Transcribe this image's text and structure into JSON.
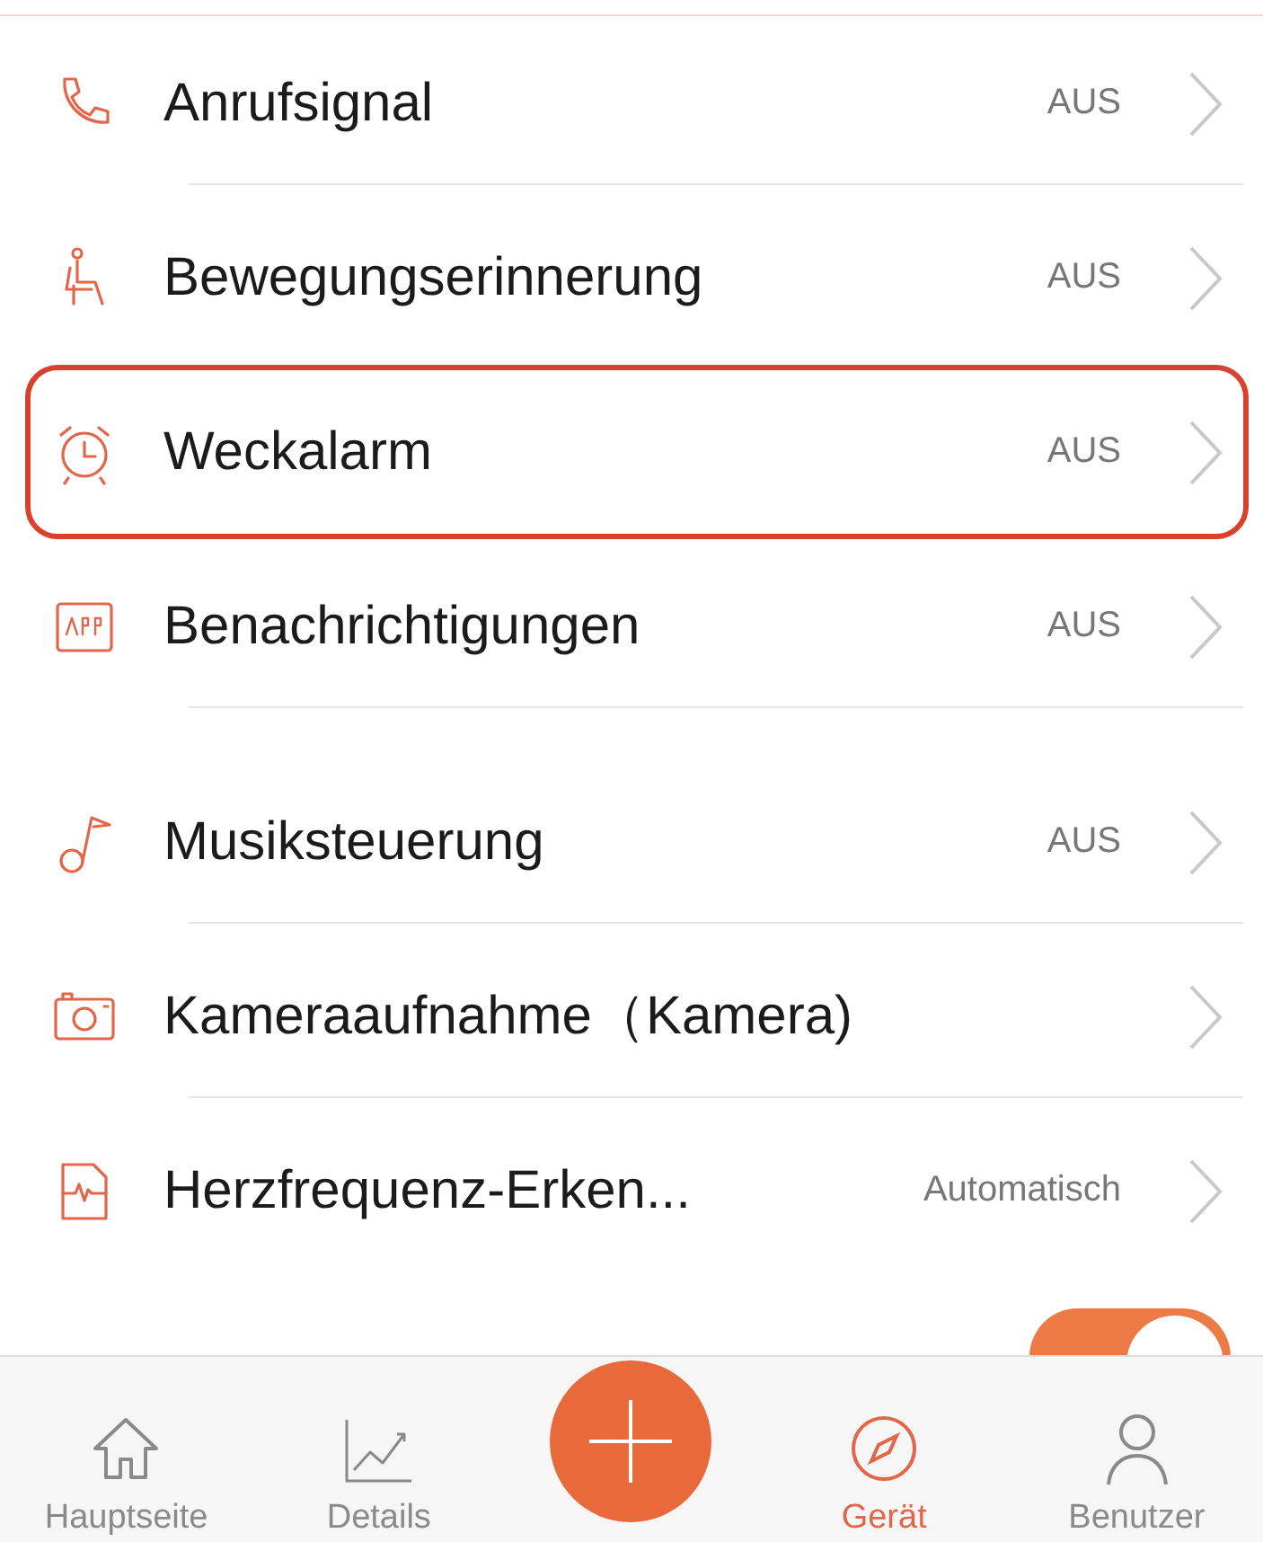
{
  "settings": [
    {
      "label": "Anrufsignal",
      "value": "AUS",
      "highlighted": false
    },
    {
      "label": "Bewegungserinnerung",
      "value": "AUS",
      "highlighted": false
    },
    {
      "label": "Weckalarm",
      "value": "AUS",
      "highlighted": true
    },
    {
      "label": "Benachrichtigungen",
      "value": "AUS",
      "highlighted": false
    },
    {
      "label": "Musiksteuerung",
      "value": "AUS",
      "highlighted": false
    },
    {
      "label": "Kameraaufnahme（Kamera)",
      "highlighted": false
    },
    {
      "label": "Herzfrequenz-Erken...",
      "value": "Automatisch",
      "highlighted": false
    }
  ],
  "partial_row": {
    "on": true
  },
  "tab_bar": [
    {
      "kind": "tab",
      "label": "Hauptseite",
      "selected": false
    },
    {
      "kind": "tab",
      "label": "Details",
      "selected": false
    },
    {
      "kind": "add"
    },
    {
      "kind": "tab",
      "label": "Gerät",
      "selected": true
    },
    {
      "kind": "tab",
      "label": "Benutzer",
      "selected": false
    }
  ]
}
